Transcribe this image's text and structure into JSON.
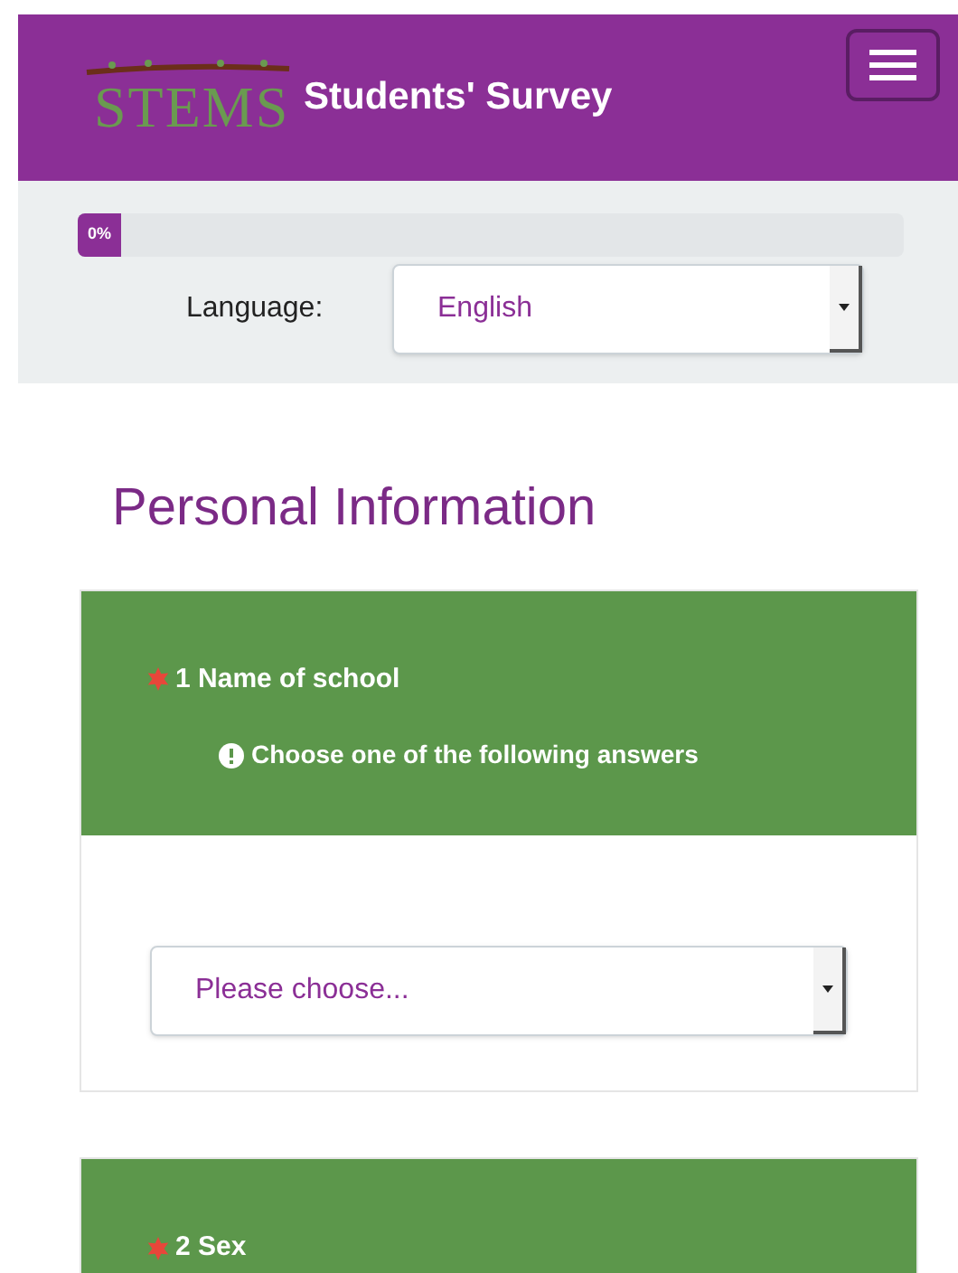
{
  "header": {
    "logo": "STEMS",
    "title": "Students' Survey"
  },
  "progress": {
    "level": 0,
    "label": "0%"
  },
  "language": {
    "label": "Language:",
    "value": "English"
  },
  "section": {
    "title": "Personal Information"
  },
  "questions": [
    {
      "number": "1",
      "title": "Name of school",
      "required": true,
      "hint": "Choose one of the following answers",
      "select": {
        "value": "Please choose..."
      }
    },
    {
      "number": "2",
      "title": "Sex",
      "required": true
    }
  ]
}
